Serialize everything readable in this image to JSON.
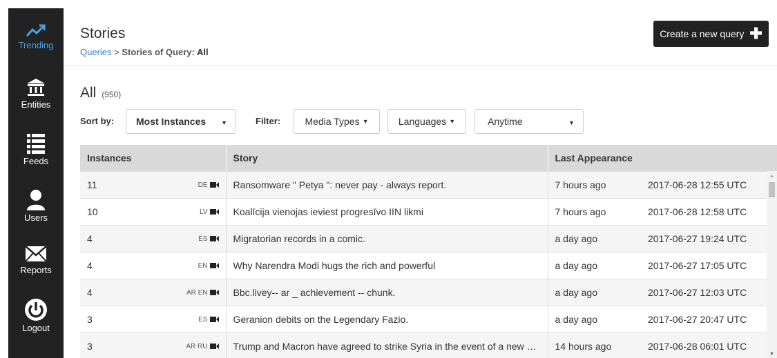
{
  "sidebar": {
    "items": [
      {
        "label": "Trending",
        "icon": "trending-icon"
      },
      {
        "label": "Entities",
        "icon": "bank-icon"
      },
      {
        "label": "Feeds",
        "icon": "list-icon"
      },
      {
        "label": "Users",
        "icon": "user-icon"
      },
      {
        "label": "Reports",
        "icon": "envelope-icon"
      },
      {
        "label": "Logout",
        "icon": "power-icon"
      }
    ],
    "active_color": "#4aa3df",
    "background": "#222222"
  },
  "header": {
    "title": "Stories",
    "breadcrumb_link": "Queries",
    "breadcrumb_sep": " > ",
    "breadcrumb_prefix": "Stories of Query: ",
    "breadcrumb_current": "All",
    "create_button": "Create a new query",
    "create_button_icon": "plus-icon"
  },
  "section": {
    "title": "All",
    "count": "(950)"
  },
  "toolbar": {
    "sort_label": "Sort by:",
    "sort_value": "Most Instances",
    "filter_label": "Filter:",
    "media_types": "Media Types",
    "languages": "Languages",
    "time_value": "Anytime"
  },
  "table": {
    "headers": [
      "Instances",
      "Story",
      "Last Appearance"
    ],
    "rows": [
      {
        "instances": "11",
        "langs": "DE",
        "story": "Ransomware \" Petya \": never pay - always report.",
        "ago": "7 hours ago",
        "date": "2017-06-28 12:55 UTC"
      },
      {
        "instances": "10",
        "langs": "LV",
        "story": "Koalīcija vienojas ieviest progresīvo IIN likmi",
        "ago": "7 hours ago",
        "date": "2017-06-28 12:58 UTC"
      },
      {
        "instances": "4",
        "langs": "ES",
        "story": "Migratorian records in a comic.",
        "ago": "a day ago",
        "date": "2017-06-27 19:24 UTC"
      },
      {
        "instances": "4",
        "langs": "EN",
        "story": "Why Narendra Modi hugs the rich and powerful",
        "ago": "a day ago",
        "date": "2017-06-27 17:05 UTC"
      },
      {
        "instances": "4",
        "langs": "AR EN",
        "story": "Bbc.livey-- ar _ achievement -- chunk.",
        "ago": "a day ago",
        "date": "2017-06-27 12:03 UTC"
      },
      {
        "instances": "3",
        "langs": "ES",
        "story": "Geranion debits on the Legendary Fazio.",
        "ago": "a day ago",
        "date": "2017-06-27 20:47 UTC"
      },
      {
        "instances": "3",
        "langs": "AR RU",
        "story": "Trump and Macron have agreed to strike Syria in the event of a new chemical attack",
        "ago": "14 hours ago",
        "date": "2017-06-28 06:01 UTC"
      }
    ]
  }
}
